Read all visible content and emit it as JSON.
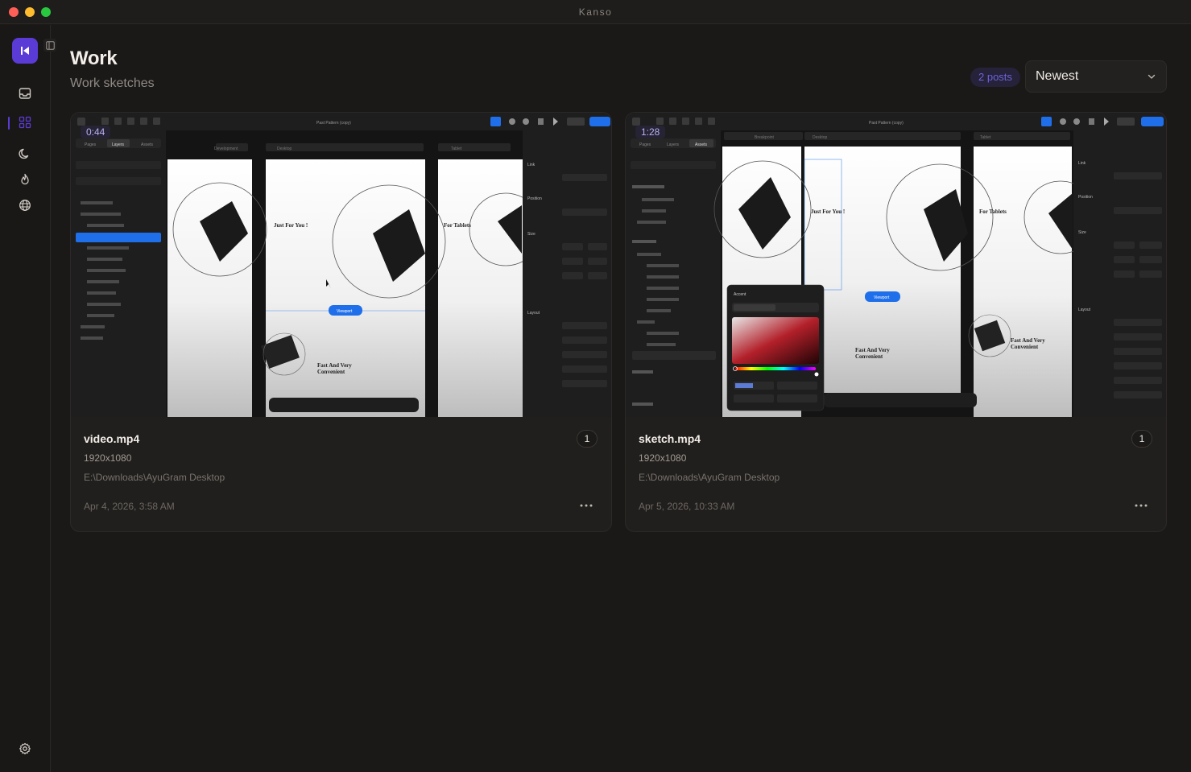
{
  "window": {
    "title": "Kanso"
  },
  "sidebar": {
    "items": [
      {
        "icon": "inbox-icon"
      },
      {
        "icon": "grid-icon",
        "active": true
      },
      {
        "icon": "moon-icon"
      },
      {
        "icon": "flame-icon"
      },
      {
        "icon": "globe-icon"
      }
    ],
    "settings_icon": "gear-icon",
    "accent": "#5b3bd6"
  },
  "header": {
    "title": "Work",
    "subtitle": "Work sketches",
    "post_count": "2 posts",
    "sort": {
      "selected": "Newest"
    }
  },
  "posts": [
    {
      "duration": "0:44",
      "filename": "video.mp4",
      "count": "1",
      "resolution": "1920x1080",
      "path": "E:\\Downloads\\AyuGram Desktop",
      "date": "Apr 4, 2026, 3:58 AM",
      "preview": {
        "doc_title": "Past Pattern (copy)",
        "tabs": [
          "Pages",
          "Layers",
          "Assets"
        ],
        "frames": [
          "Development",
          "Desktop",
          "Tablet"
        ],
        "headline1": "Just For You !",
        "headline2": "Fast And Very",
        "headline3": "Convenient",
        "headline4": "For Tablets",
        "viewport": "Viewport",
        "panel": [
          "Link",
          "Position",
          "Size",
          "Layout"
        ]
      }
    },
    {
      "duration": "1:28",
      "filename": "sketch.mp4",
      "count": "1",
      "resolution": "1920x1080",
      "path": "E:\\Downloads\\AyuGram Desktop",
      "date": "Apr 5, 2026, 10:33 AM",
      "preview": {
        "doc_title": "Past Pattern (copy)",
        "tabs": [
          "Pages",
          "Layers",
          "Assets"
        ],
        "frames": [
          "Breakpoint",
          "Desktop",
          "Tablet"
        ],
        "headline1": "Just For You !",
        "headline2": "Fast And Very",
        "headline3": "Convenient",
        "headline4": "For Tablets",
        "viewport": "Viewport",
        "panel": [
          "Link",
          "Position",
          "Size",
          "Layout"
        ],
        "picker_title": "Accent"
      }
    }
  ]
}
